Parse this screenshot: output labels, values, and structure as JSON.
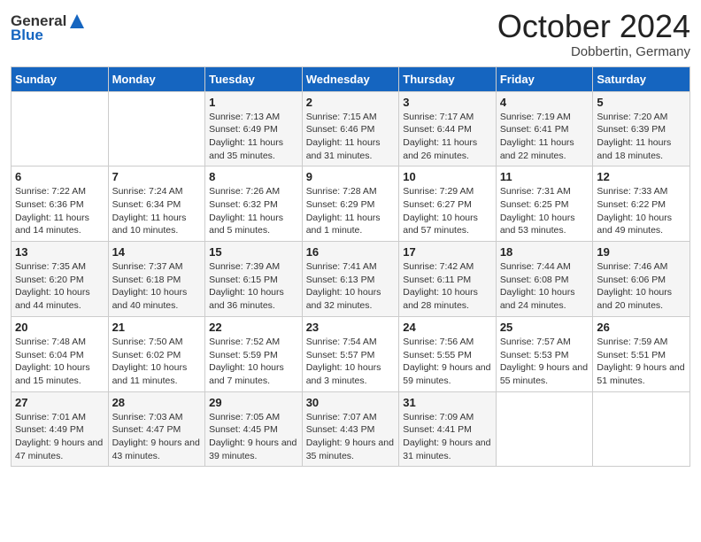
{
  "header": {
    "logo_general": "General",
    "logo_blue": "Blue",
    "month": "October 2024",
    "location": "Dobbertin, Germany"
  },
  "days_of_week": [
    "Sunday",
    "Monday",
    "Tuesday",
    "Wednesday",
    "Thursday",
    "Friday",
    "Saturday"
  ],
  "weeks": [
    [
      {
        "day": "",
        "info": ""
      },
      {
        "day": "",
        "info": ""
      },
      {
        "day": "1",
        "info": "Sunrise: 7:13 AM\nSunset: 6:49 PM\nDaylight: 11 hours and 35 minutes."
      },
      {
        "day": "2",
        "info": "Sunrise: 7:15 AM\nSunset: 6:46 PM\nDaylight: 11 hours and 31 minutes."
      },
      {
        "day": "3",
        "info": "Sunrise: 7:17 AM\nSunset: 6:44 PM\nDaylight: 11 hours and 26 minutes."
      },
      {
        "day": "4",
        "info": "Sunrise: 7:19 AM\nSunset: 6:41 PM\nDaylight: 11 hours and 22 minutes."
      },
      {
        "day": "5",
        "info": "Sunrise: 7:20 AM\nSunset: 6:39 PM\nDaylight: 11 hours and 18 minutes."
      }
    ],
    [
      {
        "day": "6",
        "info": "Sunrise: 7:22 AM\nSunset: 6:36 PM\nDaylight: 11 hours and 14 minutes."
      },
      {
        "day": "7",
        "info": "Sunrise: 7:24 AM\nSunset: 6:34 PM\nDaylight: 11 hours and 10 minutes."
      },
      {
        "day": "8",
        "info": "Sunrise: 7:26 AM\nSunset: 6:32 PM\nDaylight: 11 hours and 5 minutes."
      },
      {
        "day": "9",
        "info": "Sunrise: 7:28 AM\nSunset: 6:29 PM\nDaylight: 11 hours and 1 minute."
      },
      {
        "day": "10",
        "info": "Sunrise: 7:29 AM\nSunset: 6:27 PM\nDaylight: 10 hours and 57 minutes."
      },
      {
        "day": "11",
        "info": "Sunrise: 7:31 AM\nSunset: 6:25 PM\nDaylight: 10 hours and 53 minutes."
      },
      {
        "day": "12",
        "info": "Sunrise: 7:33 AM\nSunset: 6:22 PM\nDaylight: 10 hours and 49 minutes."
      }
    ],
    [
      {
        "day": "13",
        "info": "Sunrise: 7:35 AM\nSunset: 6:20 PM\nDaylight: 10 hours and 44 minutes."
      },
      {
        "day": "14",
        "info": "Sunrise: 7:37 AM\nSunset: 6:18 PM\nDaylight: 10 hours and 40 minutes."
      },
      {
        "day": "15",
        "info": "Sunrise: 7:39 AM\nSunset: 6:15 PM\nDaylight: 10 hours and 36 minutes."
      },
      {
        "day": "16",
        "info": "Sunrise: 7:41 AM\nSunset: 6:13 PM\nDaylight: 10 hours and 32 minutes."
      },
      {
        "day": "17",
        "info": "Sunrise: 7:42 AM\nSunset: 6:11 PM\nDaylight: 10 hours and 28 minutes."
      },
      {
        "day": "18",
        "info": "Sunrise: 7:44 AM\nSunset: 6:08 PM\nDaylight: 10 hours and 24 minutes."
      },
      {
        "day": "19",
        "info": "Sunrise: 7:46 AM\nSunset: 6:06 PM\nDaylight: 10 hours and 20 minutes."
      }
    ],
    [
      {
        "day": "20",
        "info": "Sunrise: 7:48 AM\nSunset: 6:04 PM\nDaylight: 10 hours and 15 minutes."
      },
      {
        "day": "21",
        "info": "Sunrise: 7:50 AM\nSunset: 6:02 PM\nDaylight: 10 hours and 11 minutes."
      },
      {
        "day": "22",
        "info": "Sunrise: 7:52 AM\nSunset: 5:59 PM\nDaylight: 10 hours and 7 minutes."
      },
      {
        "day": "23",
        "info": "Sunrise: 7:54 AM\nSunset: 5:57 PM\nDaylight: 10 hours and 3 minutes."
      },
      {
        "day": "24",
        "info": "Sunrise: 7:56 AM\nSunset: 5:55 PM\nDaylight: 9 hours and 59 minutes."
      },
      {
        "day": "25",
        "info": "Sunrise: 7:57 AM\nSunset: 5:53 PM\nDaylight: 9 hours and 55 minutes."
      },
      {
        "day": "26",
        "info": "Sunrise: 7:59 AM\nSunset: 5:51 PM\nDaylight: 9 hours and 51 minutes."
      }
    ],
    [
      {
        "day": "27",
        "info": "Sunrise: 7:01 AM\nSunset: 4:49 PM\nDaylight: 9 hours and 47 minutes."
      },
      {
        "day": "28",
        "info": "Sunrise: 7:03 AM\nSunset: 4:47 PM\nDaylight: 9 hours and 43 minutes."
      },
      {
        "day": "29",
        "info": "Sunrise: 7:05 AM\nSunset: 4:45 PM\nDaylight: 9 hours and 39 minutes."
      },
      {
        "day": "30",
        "info": "Sunrise: 7:07 AM\nSunset: 4:43 PM\nDaylight: 9 hours and 35 minutes."
      },
      {
        "day": "31",
        "info": "Sunrise: 7:09 AM\nSunset: 4:41 PM\nDaylight: 9 hours and 31 minutes."
      },
      {
        "day": "",
        "info": ""
      },
      {
        "day": "",
        "info": ""
      }
    ]
  ]
}
